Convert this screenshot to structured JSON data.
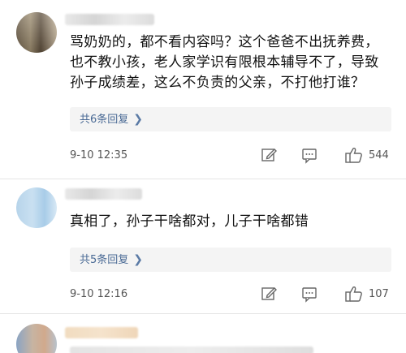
{
  "comments": [
    {
      "text_lines": [
        "骂奶奶的，都不看内容吗？这个爸爸不出抚养费，",
        "也不教小孩，老人家学识有限根本辅导不了，导致",
        "孙子成绩差，这么不负责的父亲，不打他打谁？"
      ],
      "replies_label": "共6条回复",
      "time": "9-10 12:35",
      "likes": "544",
      "icons": [
        "edit-icon",
        "comment-icon",
        "thumbs-up-icon"
      ]
    },
    {
      "text_lines": [
        "真相了，孙子干啥都对，儿子干啥都错"
      ],
      "replies_label": "共5条回复",
      "time": "9-10 12:16",
      "likes": "107",
      "icons": [
        "edit-icon",
        "comment-icon",
        "thumbs-up-icon"
      ]
    }
  ]
}
